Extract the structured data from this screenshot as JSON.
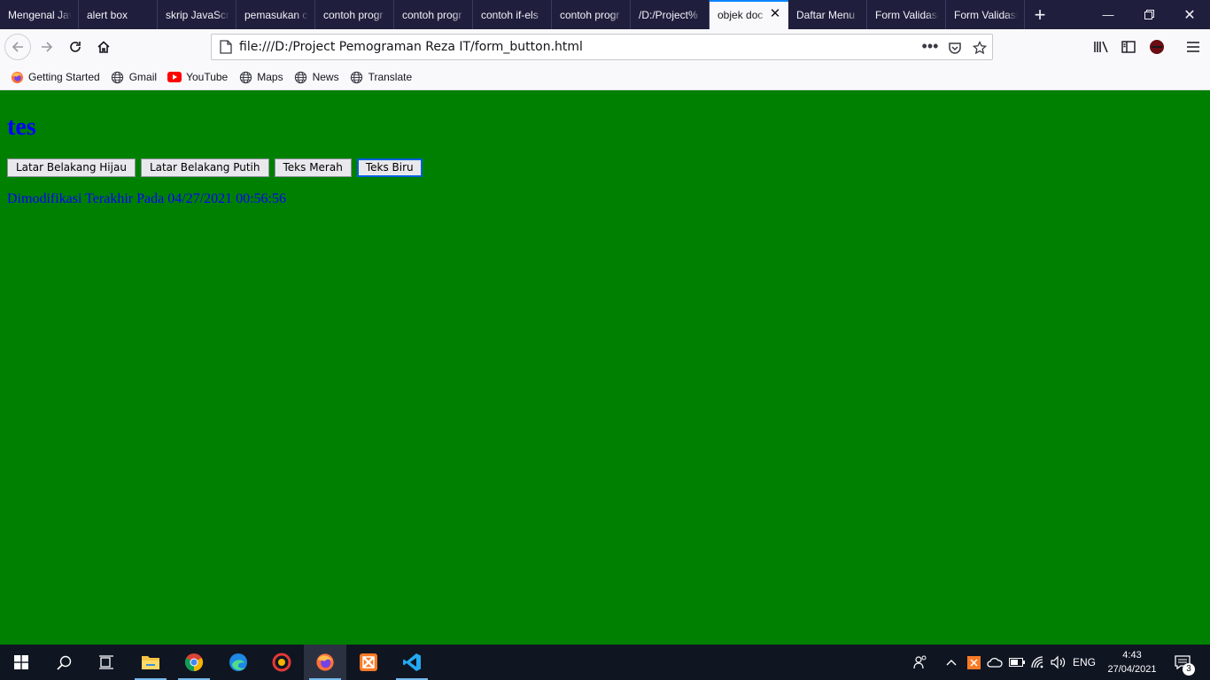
{
  "browser": {
    "tabs": [
      {
        "label": "Mengenal Jav"
      },
      {
        "label": "alert box"
      },
      {
        "label": "skrip JavaScri"
      },
      {
        "label": "pemasukan c"
      },
      {
        "label": "contoh progr"
      },
      {
        "label": "contoh progr"
      },
      {
        "label": "contoh if-els"
      },
      {
        "label": "contoh progr"
      },
      {
        "label": "/D:/Project%"
      },
      {
        "label": "objek doc"
      },
      {
        "label": "Daftar Menu"
      },
      {
        "label": "Form Validasi"
      },
      {
        "label": "Form Validasi"
      }
    ],
    "active_tab_index": 9,
    "url": "file:///D:/Project Pemograman Reza IT/form_button.html",
    "accent_color": "#0a84ff"
  },
  "bookmarks": [
    {
      "label": "Getting Started",
      "icon": "firefox-icon"
    },
    {
      "label": "Gmail",
      "icon": "globe-icon"
    },
    {
      "label": "YouTube",
      "icon": "youtube-icon"
    },
    {
      "label": "Maps",
      "icon": "globe-icon"
    },
    {
      "label": "News",
      "icon": "globe-icon"
    },
    {
      "label": "Translate",
      "icon": "globe-icon"
    }
  ],
  "page": {
    "background_color": "#008000",
    "text_color": "#0000ff",
    "heading": "tes",
    "buttons": [
      {
        "label": "Latar Belakang Hijau"
      },
      {
        "label": "Latar Belakang Putih"
      },
      {
        "label": "Teks Merah"
      },
      {
        "label": "Teks Biru"
      }
    ],
    "last_modified": "Dimodifikasi Terakhir Pada 04/27/2021 00:56:56"
  },
  "taskbar": {
    "language": "ENG",
    "time": "4:43",
    "date": "27/04/2021",
    "notification_count": "3"
  }
}
